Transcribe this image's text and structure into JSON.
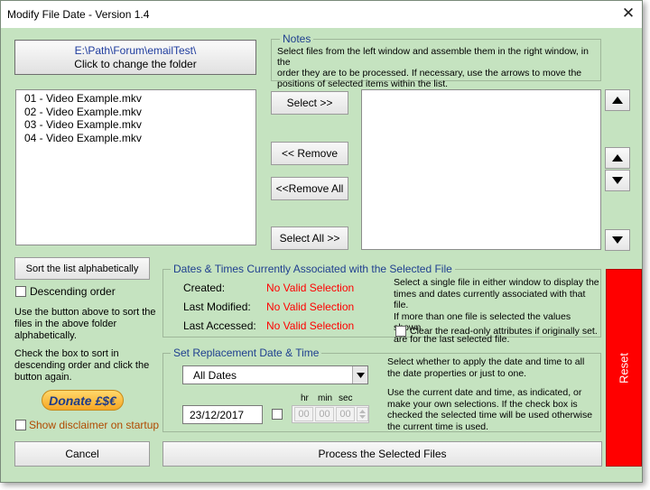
{
  "window": {
    "title": "Modify File Date - Version 1.4",
    "close_glyph": "✕"
  },
  "folder_button": {
    "path": "E:\\Path\\Forum\\emailTest\\",
    "action": "Click to change the folder"
  },
  "left_list": {
    "items": [
      "01 - Video Example.mkv",
      "02 - Video Example.mkv",
      "03 - Video Example.mkv",
      "04 - Video Example.mkv"
    ]
  },
  "notes": {
    "legend": "Notes",
    "lines": [
      "Select files from the left window and assemble them in the right window, in the",
      "order they are to be processed. If necessary, use the arrows to move the",
      "positions of selected items within the list."
    ]
  },
  "transfer": {
    "select": "Select >>",
    "remove": "<< Remove",
    "remove_all": "<<Remove All",
    "select_all": "Select All >>"
  },
  "sort": {
    "button": "Sort the list alphabetically",
    "descending_label": "Descending order",
    "descending_checked": false,
    "help1": [
      "Use the button above to sort the",
      "files in the above folder",
      "alphabetically."
    ],
    "help2": [
      "Check the box to sort in",
      "descending order and click the",
      "button again."
    ]
  },
  "donate": {
    "label": "Donate £$€"
  },
  "disclaimer": {
    "label": "Show disclaimer on startup",
    "checked": false
  },
  "current_dates": {
    "legend": "Dates & Times Currently Associated with the Selected File",
    "created_label": "Created:",
    "created_value": "No Valid Selection",
    "modified_label": "Last Modified:",
    "modified_value": "No Valid Selection",
    "accessed_label": "Last Accessed:",
    "accessed_value": "No Valid Selection",
    "info": [
      "Select a single file in either window to display the",
      "times and dates currently associated with that file.",
      "If more than one file is selected the values shown",
      "are for the last selected file."
    ],
    "readonly_label": "Clear the read-only attributes if originally set.",
    "readonly_checked": false
  },
  "replacement": {
    "legend": "Set Replacement Date & Time",
    "date_option": "All Dates",
    "date_value": "23/12/2017",
    "use_time_checked": false,
    "hr_label": "hr",
    "min_label": "min",
    "sec_label": "sec",
    "hr": "00",
    "min": "00",
    "sec": "00",
    "info1": [
      "Select whether to apply the date and time to all",
      "the date properties or just to one."
    ],
    "info2": [
      "Use the current date and time, as indicated, or",
      "make your own selections. If the check box is",
      "checked the selected time will be used otherwise",
      "the current time is used."
    ]
  },
  "reset": {
    "label": "Reset",
    "color": "#ff0000"
  },
  "bottom": {
    "cancel": "Cancel",
    "process": "Process the Selected Files"
  },
  "colors": {
    "background": "#c5e3c0",
    "legend": "#1f3f8f",
    "error": "#ff0000",
    "path": "#1f3c9e"
  }
}
